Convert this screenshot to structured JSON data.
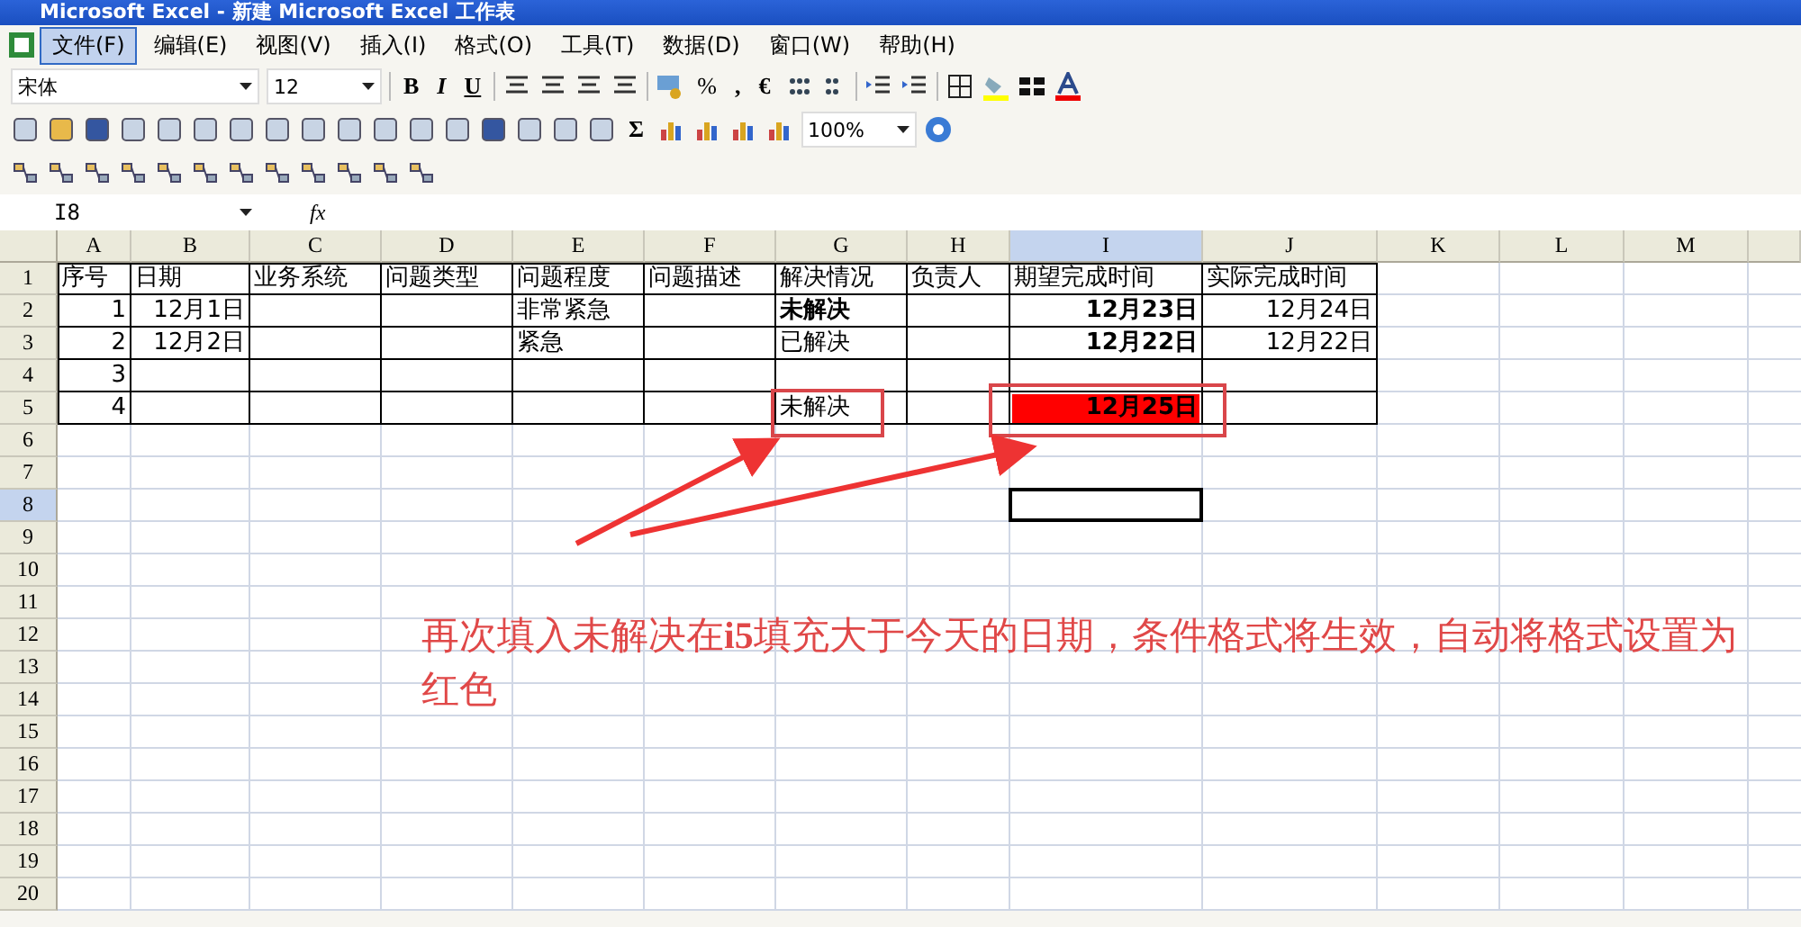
{
  "window": {
    "title": "Microsoft Excel - 新建 Microsoft Excel 工作表"
  },
  "menu": [
    {
      "label": "文件(F)",
      "selected": true
    },
    {
      "label": "编辑(E)",
      "selected": false
    },
    {
      "label": "视图(V)",
      "selected": false
    },
    {
      "label": "插入(I)",
      "selected": false
    },
    {
      "label": "格式(O)",
      "selected": false
    },
    {
      "label": "工具(T)",
      "selected": false
    },
    {
      "label": "数据(D)",
      "selected": false
    },
    {
      "label": "窗口(W)",
      "selected": false
    },
    {
      "label": "帮助(H)",
      "selected": false
    }
  ],
  "formatting_toolbar": {
    "font": "宋体",
    "size": "12",
    "bold": "B",
    "italic": "I",
    "underline": "U",
    "percent": "%",
    "comma": ",",
    "euro": "€"
  },
  "standard_toolbar": {
    "sum": "Σ",
    "zoom": "100%"
  },
  "formula_bar": {
    "name_box": "I8",
    "fx": "fx"
  },
  "columns": [
    {
      "label": "A",
      "selected": false
    },
    {
      "label": "B",
      "selected": false
    },
    {
      "label": "C",
      "selected": false
    },
    {
      "label": "D",
      "selected": false
    },
    {
      "label": "E",
      "selected": false
    },
    {
      "label": "F",
      "selected": false
    },
    {
      "label": "G",
      "selected": false
    },
    {
      "label": "H",
      "selected": false
    },
    {
      "label": "I",
      "selected": true
    },
    {
      "label": "J",
      "selected": false
    },
    {
      "label": "K",
      "selected": false
    },
    {
      "label": "L",
      "selected": false
    },
    {
      "label": "M",
      "selected": false
    }
  ],
  "row_headers": [
    {
      "label": "1",
      "selected": false
    },
    {
      "label": "2",
      "selected": false
    },
    {
      "label": "3",
      "selected": false
    },
    {
      "label": "4",
      "selected": false
    },
    {
      "label": "5",
      "selected": false
    },
    {
      "label": "6",
      "selected": false
    },
    {
      "label": "7",
      "selected": false
    },
    {
      "label": "8",
      "selected": true
    },
    {
      "label": "9",
      "selected": false
    },
    {
      "label": "10",
      "selected": false
    },
    {
      "label": "11",
      "selected": false
    },
    {
      "label": "12",
      "selected": false
    },
    {
      "label": "13",
      "selected": false
    },
    {
      "label": "14",
      "selected": false
    },
    {
      "label": "15",
      "selected": false
    },
    {
      "label": "16",
      "selected": false
    },
    {
      "label": "17",
      "selected": false
    },
    {
      "label": "18",
      "selected": false
    },
    {
      "label": "19",
      "selected": false
    },
    {
      "label": "20",
      "selected": false
    }
  ],
  "rows": [
    [
      {
        "text": "序号",
        "kind": "text",
        "bold": false,
        "highlighted": false
      },
      {
        "text": "日期",
        "kind": "text",
        "bold": false,
        "highlighted": false
      },
      {
        "text": "业务系统",
        "kind": "text",
        "bold": false,
        "highlighted": false
      },
      {
        "text": "问题类型",
        "kind": "text",
        "bold": false,
        "highlighted": false
      },
      {
        "text": "问题程度",
        "kind": "text",
        "bold": false,
        "highlighted": false
      },
      {
        "text": "问题描述",
        "kind": "text",
        "bold": false,
        "highlighted": false
      },
      {
        "text": "解决情况",
        "kind": "text",
        "bold": false,
        "highlighted": false
      },
      {
        "text": "负责人",
        "kind": "text",
        "bold": false,
        "highlighted": false
      },
      {
        "text": "期望完成时间",
        "kind": "text",
        "bold": false,
        "highlighted": false
      },
      {
        "text": "实际完成时间",
        "kind": "text",
        "bold": false,
        "highlighted": false
      }
    ],
    [
      {
        "text": "1",
        "kind": "number",
        "bold": false,
        "highlighted": false
      },
      {
        "text": "12月1日",
        "kind": "number",
        "bold": false,
        "highlighted": false
      },
      null,
      null,
      {
        "text": "非常紧急",
        "kind": "text",
        "bold": false,
        "highlighted": false
      },
      null,
      {
        "text": "未解决",
        "kind": "text",
        "bold": true,
        "highlighted": false
      },
      null,
      {
        "text": "12月23日",
        "kind": "number",
        "bold": true,
        "highlighted": false
      },
      {
        "text": "12月24日",
        "kind": "number",
        "bold": false,
        "highlighted": false
      }
    ],
    [
      {
        "text": "2",
        "kind": "number",
        "bold": false,
        "highlighted": false
      },
      {
        "text": "12月2日",
        "kind": "number",
        "bold": false,
        "highlighted": false
      },
      null,
      null,
      {
        "text": "紧急",
        "kind": "text",
        "bold": false,
        "highlighted": false
      },
      null,
      {
        "text": "已解决",
        "kind": "text",
        "bold": false,
        "highlighted": false
      },
      null,
      {
        "text": "12月22日",
        "kind": "number",
        "bold": true,
        "highlighted": false
      },
      {
        "text": "12月22日",
        "kind": "number",
        "bold": false,
        "highlighted": false
      }
    ],
    [
      {
        "text": "3",
        "kind": "number",
        "bold": false,
        "highlighted": false
      },
      null,
      null,
      null,
      null,
      null,
      null,
      null,
      null,
      null
    ],
    [
      {
        "text": "4",
        "kind": "number",
        "bold": false,
        "highlighted": false
      },
      null,
      null,
      null,
      null,
      null,
      {
        "text": "未解决",
        "kind": "text",
        "bold": false,
        "highlighted": false
      },
      null,
      {
        "text": "12月25日",
        "kind": "number",
        "bold": true,
        "highlighted": true
      },
      null
    ]
  ],
  "annotation": {
    "text": "再次填入未解决在**i5**填充大于今天的日期，条件格式将生效，自动将格式设置为红色"
  }
}
